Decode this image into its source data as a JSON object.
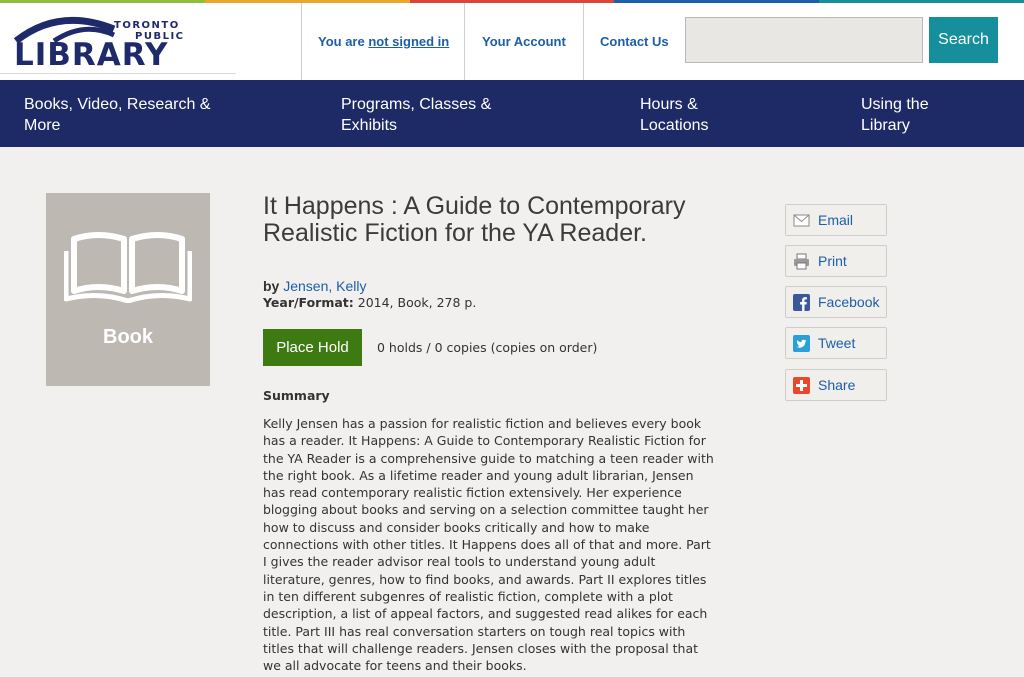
{
  "logo": {
    "toronto": "TORONTO",
    "public": "PUBLIC",
    "library": "LIBRARY"
  },
  "header": {
    "signed_in_prefix": "You are ",
    "signed_in_link": "not signed in",
    "account": "Your Account",
    "contact": "Contact Us",
    "search_button": "Search",
    "search_value": ""
  },
  "nav": {
    "items": [
      {
        "line1": "Books, Video, Research &",
        "line2": "More"
      },
      {
        "line1": "Programs, Classes &",
        "line2": "Exhibits"
      },
      {
        "line1": "Hours &",
        "line2": "Locations"
      },
      {
        "line1": "Using the",
        "line2": "Library"
      }
    ]
  },
  "item": {
    "cover_label": "Book",
    "title": "It Happens : A Guide to Contemporary Realistic Fiction for the YA Reader.",
    "by_label": "by",
    "author_last": "Jensen",
    "author_first": "Kelly",
    "year_format_label": "Year/Format:",
    "year_format_value": "2014, Book, 278 p.",
    "place_hold": "Place Hold",
    "holds_info": "0 holds / 0 copies (copies on order)",
    "summary_heading": "Summary",
    "summary_lines": [
      "Kelly Jensen has a passion for realistic fiction and believes every book",
      "has a reader. It Happens: A Guide to Contemporary Realistic Fiction for",
      "the YA Reader is a comprehensive guide to matching a teen reader with",
      "the right book. As a lifetime reader and young adult librarian, Jensen",
      "has read contemporary realistic fiction extensively. Her experience",
      "blogging about books and serving on a selection committee taught her",
      "how to discuss and consider books critically and how to make",
      "connections with other titles. It Happens does all of that and more. Part",
      "I gives the reader advisor real tools to understand young adult",
      "literature, genres, how to find books, and awards. Part II explores titles",
      "in ten different subgenres of realistic fiction, complete with a plot",
      "description, a list of appeal factors, and suggested read alikes for each",
      "title. Part III has real conversation starters on tough real topics with",
      "titles that will challenge readers. Jensen closes with the proposal that",
      "we all advocate for teens and their books."
    ]
  },
  "share": {
    "email": "Email",
    "print": "Print",
    "facebook": "Facebook",
    "tweet": "Tweet",
    "share": "Share"
  },
  "colors": {
    "brand_navy": "#1e2a66",
    "search_teal": "#168f9c",
    "hold_green": "#3d7a12",
    "link_blue": "#1c5ea8"
  },
  "icons": [
    "open-book-icon",
    "email-icon",
    "printer-icon",
    "facebook-icon",
    "twitter-icon",
    "plus-share-icon"
  ]
}
